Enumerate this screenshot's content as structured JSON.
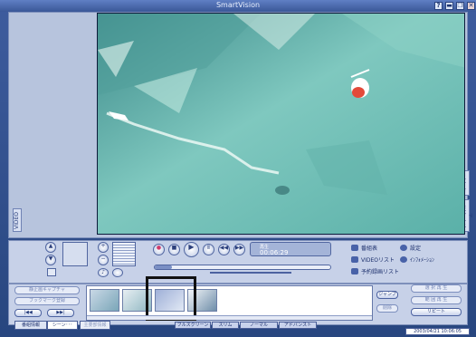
{
  "window": {
    "title": "SmartVision"
  },
  "title_buttons": {
    "help": "?",
    "minimize": "▬",
    "restore": "❐",
    "close": "✕"
  },
  "side_tabs": {
    "video": "VIDEO",
    "live": "ライブ",
    "timeshift": "タイムシフト"
  },
  "playback": {
    "time_label": "再生",
    "time_value": "00:06:29",
    "progress": 0.1
  },
  "menu": {
    "record": "番組表",
    "settings": "設定",
    "video_list": "VIDEOリスト",
    "info": "ｲﾝﾌｫﾒｰｼｮﾝ",
    "reservation": "予約録画リスト"
  },
  "scene_buttons": {
    "still_capture": "静止画キャプチャ",
    "bookmark": "ブックマーク登録",
    "jump": "ジャンプ",
    "delete": "削除",
    "select_play": "選 択 再 生",
    "continuous_play": "範 囲 再 生",
    "repeat": "リピート"
  },
  "bottom_tabs": {
    "program_info": "番組情報",
    "scene": "シーン･･･",
    "cm": "主要部情報"
  },
  "view_modes": {
    "fullscreen": "フルスクリーン",
    "slim": "スリム",
    "normal": "ノーマル",
    "advanced": "アドバンスト"
  },
  "status": {
    "datetime": "2003/04/21 10:06:05"
  },
  "colors": {
    "window_bg": "#3e5c9e",
    "panel": "#c7d1e8",
    "accent": "#203778"
  }
}
